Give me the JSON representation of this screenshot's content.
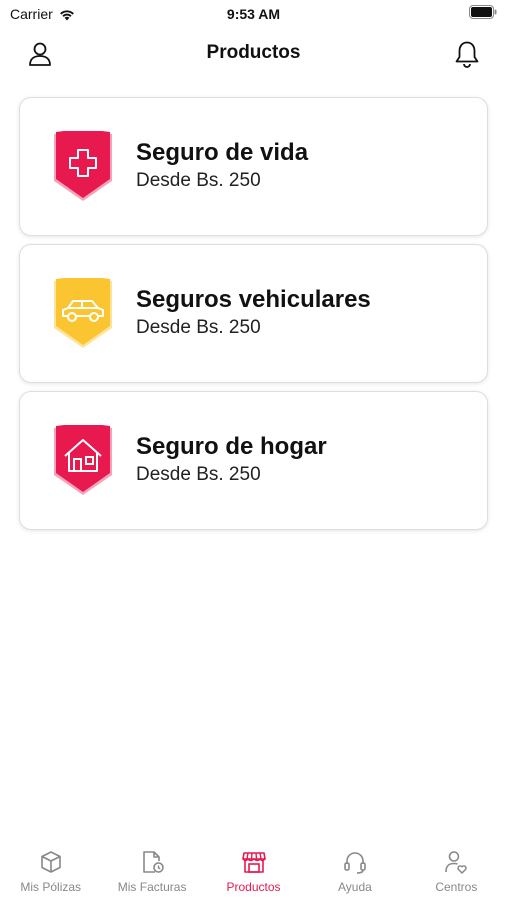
{
  "status_bar": {
    "carrier": "Carrier",
    "time": "9:53 AM"
  },
  "nav": {
    "title": "Productos"
  },
  "products": [
    {
      "title": "Seguro de vida",
      "subtitle": "Desde Bs. 250",
      "icon": "life-shield-icon",
      "color": "#e8194f"
    },
    {
      "title": "Seguros vehiculares",
      "subtitle": "Desde Bs. 250",
      "icon": "car-shield-icon",
      "color": "#fbc531"
    },
    {
      "title": "Seguro de hogar",
      "subtitle": "Desde Bs. 250",
      "icon": "home-shield-icon",
      "color": "#e8194f"
    }
  ],
  "tabs": [
    {
      "label": "Mis Pólizas",
      "icon": "box-icon"
    },
    {
      "label": "Mis Facturas",
      "icon": "invoice-icon"
    },
    {
      "label": "Productos",
      "icon": "store-icon",
      "active": true
    },
    {
      "label": "Ayuda",
      "icon": "headset-icon"
    },
    {
      "label": "Centros",
      "icon": "user-heart-icon"
    }
  ],
  "colors": {
    "accent": "#e8194f",
    "yellow": "#fbc531",
    "inactive": "#888888"
  }
}
